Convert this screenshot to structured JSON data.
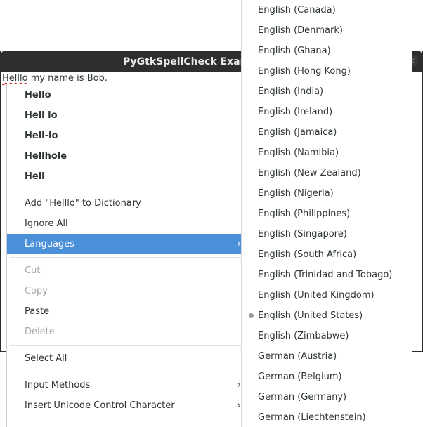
{
  "window": {
    "title": "PyGtkSpellCheck Example",
    "close_icon": "close-icon"
  },
  "textview": {
    "misspelled_word": "Helllo",
    "rest_text": " my name is Bob."
  },
  "context_menu": {
    "suggestions": [
      "Hello",
      "Hell lo",
      "Hell-lo",
      "Hellhole",
      "Hell"
    ],
    "add_to_dictionary": "Add \"Helllo\" to Dictionary",
    "ignore_all": "Ignore All",
    "languages": "Languages",
    "cut": "Cut",
    "copy": "Copy",
    "paste": "Paste",
    "delete": "Delete",
    "select_all": "Select All",
    "input_methods": "Input Methods",
    "insert_unicode": "Insert Unicode Control Character",
    "submenu_arrow": "›",
    "active_color": "#4a90d9"
  },
  "languages_submenu": {
    "selected": "English (United States)",
    "items": [
      "English (Canada)",
      "English (Denmark)",
      "English (Ghana)",
      "English (Hong Kong)",
      "English (India)",
      "English (Ireland)",
      "English (Jamaica)",
      "English (Namibia)",
      "English (New Zealand)",
      "English (Nigeria)",
      "English (Philippines)",
      "English (Singapore)",
      "English (South Africa)",
      "English (Trinidad and Tobago)",
      "English (United Kingdom)",
      "English (United States)",
      "English (Zimbabwe)",
      "German (Austria)",
      "German (Belgium)",
      "German (Germany)",
      "German (Liechtenstein)"
    ]
  }
}
